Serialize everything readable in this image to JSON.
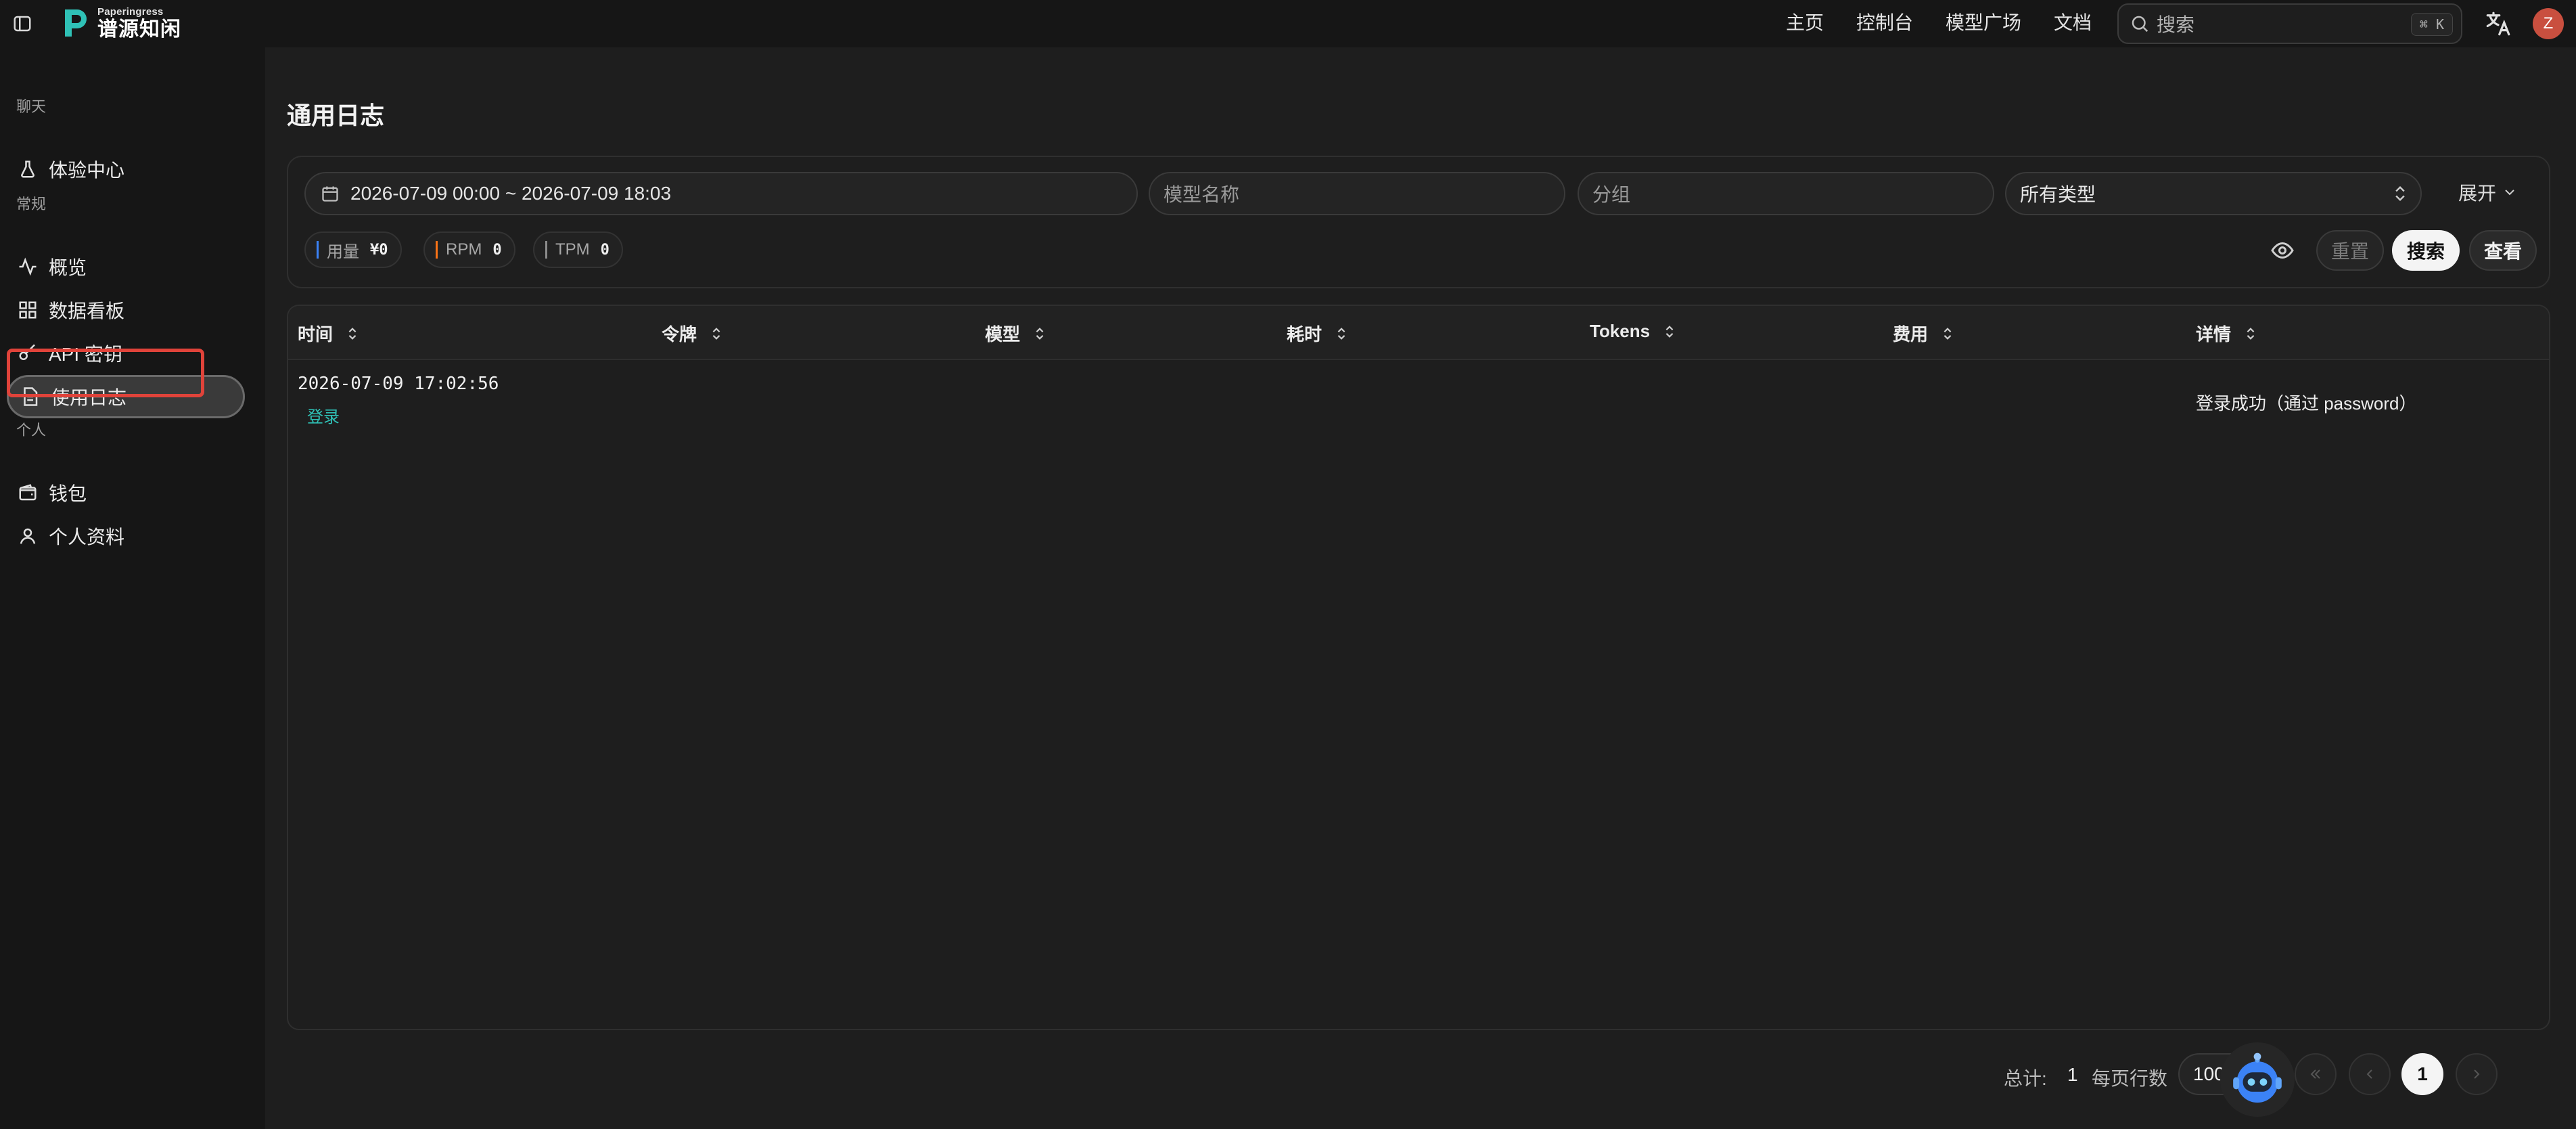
{
  "app": {
    "brand_en": "Paperingress",
    "brand_cn": "谱源知闲",
    "accent_color": "#2fc1b6"
  },
  "topnav": {
    "links": [
      "主页",
      "控制台",
      "模型广场",
      "文档"
    ],
    "search_placeholder": "搜索",
    "search_shortcut": "⌘ K",
    "avatar_letter": "Z"
  },
  "sidebar": {
    "sections": [
      {
        "label": "聊天",
        "items": [
          {
            "label": "体验中心",
            "icon": "flask-icon"
          }
        ]
      },
      {
        "label": "常规",
        "items": [
          {
            "label": "概览",
            "icon": "activity-icon"
          },
          {
            "label": "数据看板",
            "icon": "dashboard-icon"
          },
          {
            "label": "API 密钥",
            "icon": "key-icon"
          },
          {
            "label": "使用日志",
            "icon": "document-icon",
            "active": true
          }
        ]
      },
      {
        "label": "个人",
        "items": [
          {
            "label": "钱包",
            "icon": "wallet-icon"
          },
          {
            "label": "个人资料",
            "icon": "user-icon"
          }
        ]
      }
    ]
  },
  "page": {
    "title": "通用日志"
  },
  "filters": {
    "date_range": "2026-07-09 00:00 ~ 2026-07-09 18:03",
    "model_placeholder": "模型名称",
    "group_placeholder": "分组",
    "type_selected": "所有类型",
    "expand_label": "展开",
    "stats": [
      {
        "key": "用量",
        "value": "¥0",
        "color": "#3b82f6"
      },
      {
        "key": "RPM",
        "value": "0",
        "color": "#f97316"
      },
      {
        "key": "TPM",
        "value": "0",
        "color": "#8b8b8b"
      }
    ],
    "reset_label": "重置",
    "search_label": "搜索",
    "view_label": "查看"
  },
  "table": {
    "columns": [
      "时间",
      "令牌",
      "模型",
      "耗时",
      "Tokens",
      "费用",
      "详情"
    ],
    "rows": [
      {
        "time": "2026-07-09 17:02:56",
        "type": "登录",
        "token": "",
        "model": "",
        "duration": "",
        "tokens": "",
        "cost": "",
        "detail": "登录成功（通过 password）"
      }
    ]
  },
  "pagination": {
    "total_label": "总计:",
    "total": "1",
    "per_page_label": "每页行数",
    "page_size": "100",
    "current_page": "1"
  }
}
